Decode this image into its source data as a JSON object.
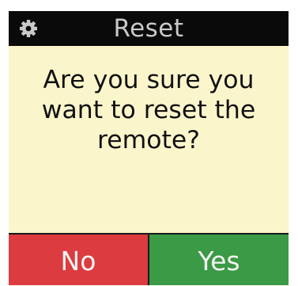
{
  "header": {
    "title": "Reset",
    "icon": "gear-icon",
    "background_color": "#0a0a0a",
    "title_color": "#c9c9c9"
  },
  "dialog": {
    "message": "Are you sure you\nwant to reset the\nremote?",
    "background_color": "#fbf5cb"
  },
  "buttons": {
    "no_label": "No",
    "yes_label": "Yes",
    "no_color": "#dc3b3f",
    "yes_color": "#3b9a45"
  }
}
